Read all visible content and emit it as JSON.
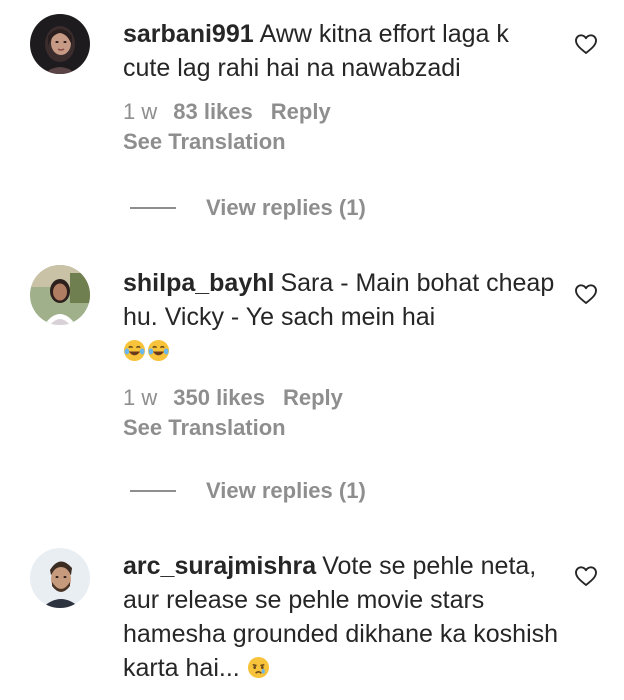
{
  "comments": [
    {
      "username": "sarbani991",
      "text": "Aww kitna effort laga k cute lag rahi hai na nawabzadi",
      "time": "1 w",
      "likes": "83 likes",
      "reply_label": "Reply",
      "translation_label": "See Translation",
      "view_replies_label": "View replies (1)"
    },
    {
      "username": "shilpa_bayhl",
      "text": "Sara - Main bohat cheap hu. Vicky - Ye sach mein hai",
      "emoji": "😂😂",
      "time": "1 w",
      "likes": "350 likes",
      "reply_label": "Reply",
      "translation_label": "See Translation",
      "view_replies_label": "View replies (1)"
    },
    {
      "username": "arc_surajmishra",
      "text": "Vote se pehle neta, aur release se pehle movie stars hamesha grounded dikhane ka koshish karta hai...",
      "emoji": "😢",
      "time": "",
      "likes": "",
      "reply_label": "",
      "translation_label": "",
      "view_replies_label": ""
    }
  ],
  "icons": {
    "like": "heart-outline-icon",
    "laugh": "face-with-tears-of-joy-emoji",
    "cry": "crying-face-emoji"
  },
  "colors": {
    "text": "#262626",
    "secondary": "#8e8e8e",
    "emoji_yellow": "#f7c33a"
  }
}
